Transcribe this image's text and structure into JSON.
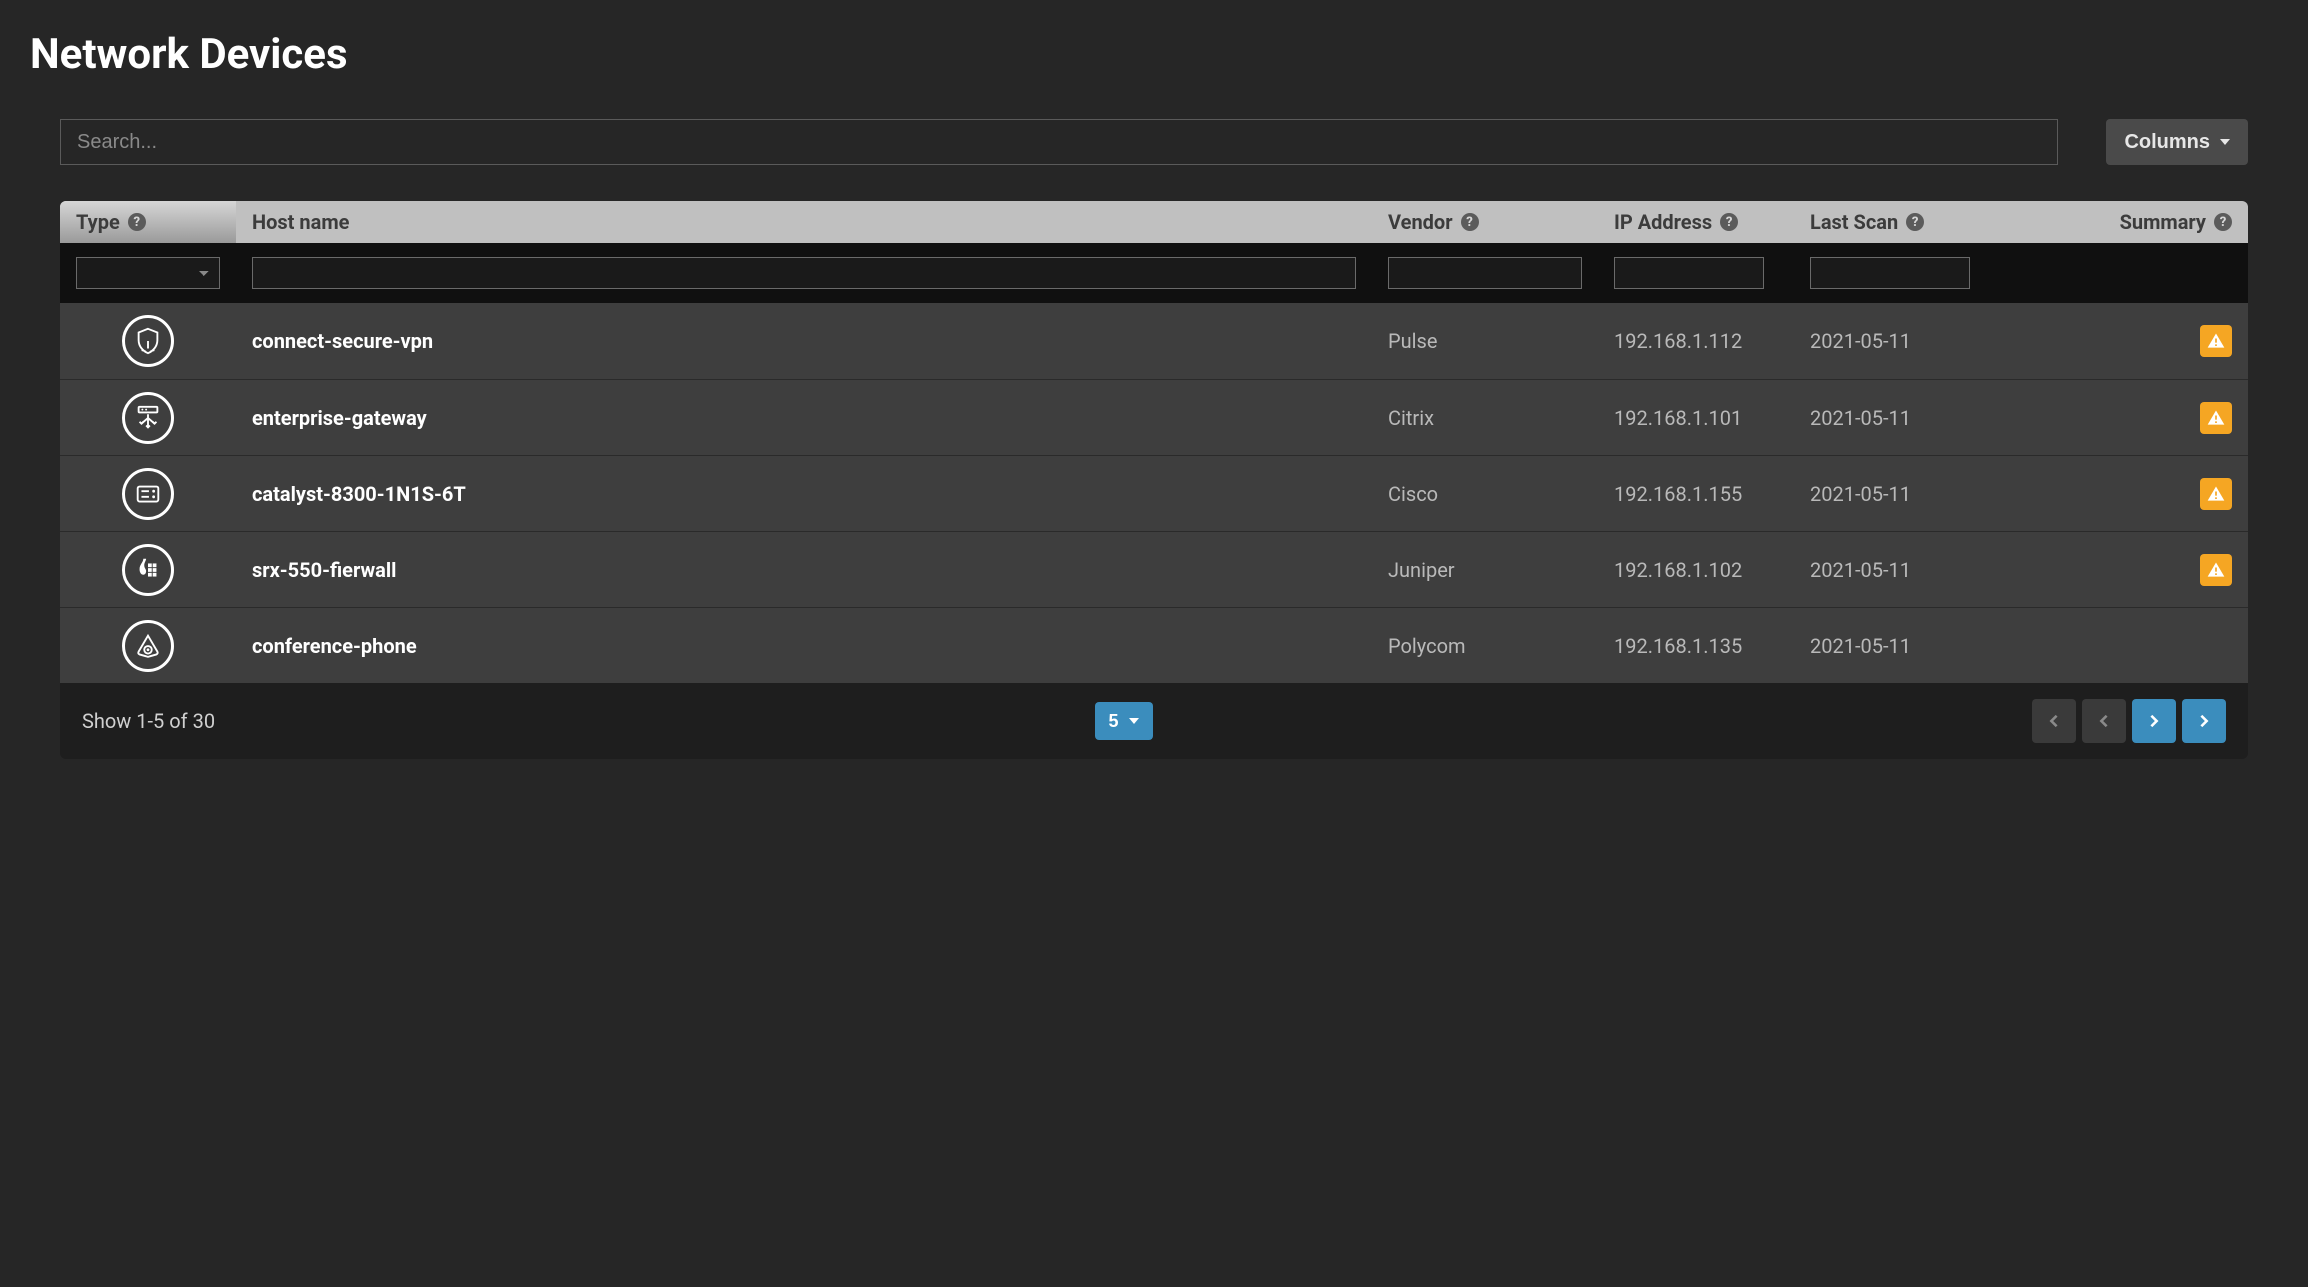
{
  "title": "Network Devices",
  "search": {
    "placeholder": "Search..."
  },
  "columns_button": "Columns",
  "columns": {
    "type": "Type",
    "hostname": "Host name",
    "vendor": "Vendor",
    "ip": "IP Address",
    "lastscan": "Last Scan",
    "summary": "Summary"
  },
  "rows": [
    {
      "icon": "vpn",
      "hostname": "connect-secure-vpn",
      "vendor": "Pulse",
      "ip": "192.168.1.112",
      "lastscan": "2021-05-11",
      "status": "warning"
    },
    {
      "icon": "gateway",
      "hostname": "enterprise-gateway",
      "vendor": "Citrix",
      "ip": "192.168.1.101",
      "lastscan": "2021-05-11",
      "status": "warning"
    },
    {
      "icon": "switch",
      "hostname": "catalyst-8300-1N1S-6T",
      "vendor": "Cisco",
      "ip": "192.168.1.155",
      "lastscan": "2021-05-11",
      "status": "warning"
    },
    {
      "icon": "firewall",
      "hostname": "srx-550-fierwall",
      "vendor": "Juniper",
      "ip": "192.168.1.102",
      "lastscan": "2021-05-11",
      "status": "warning"
    },
    {
      "icon": "phone",
      "hostname": "conference-phone",
      "vendor": "Polycom",
      "ip": "192.168.1.135",
      "lastscan": "2021-05-11",
      "status": "none"
    }
  ],
  "footer": {
    "showing": "Show 1-5 of 30",
    "page_size": "5"
  },
  "icons": {
    "vpn": "shield-icon",
    "gateway": "gateway-icon",
    "switch": "switch-icon",
    "firewall": "firewall-icon",
    "phone": "phone-icon"
  }
}
